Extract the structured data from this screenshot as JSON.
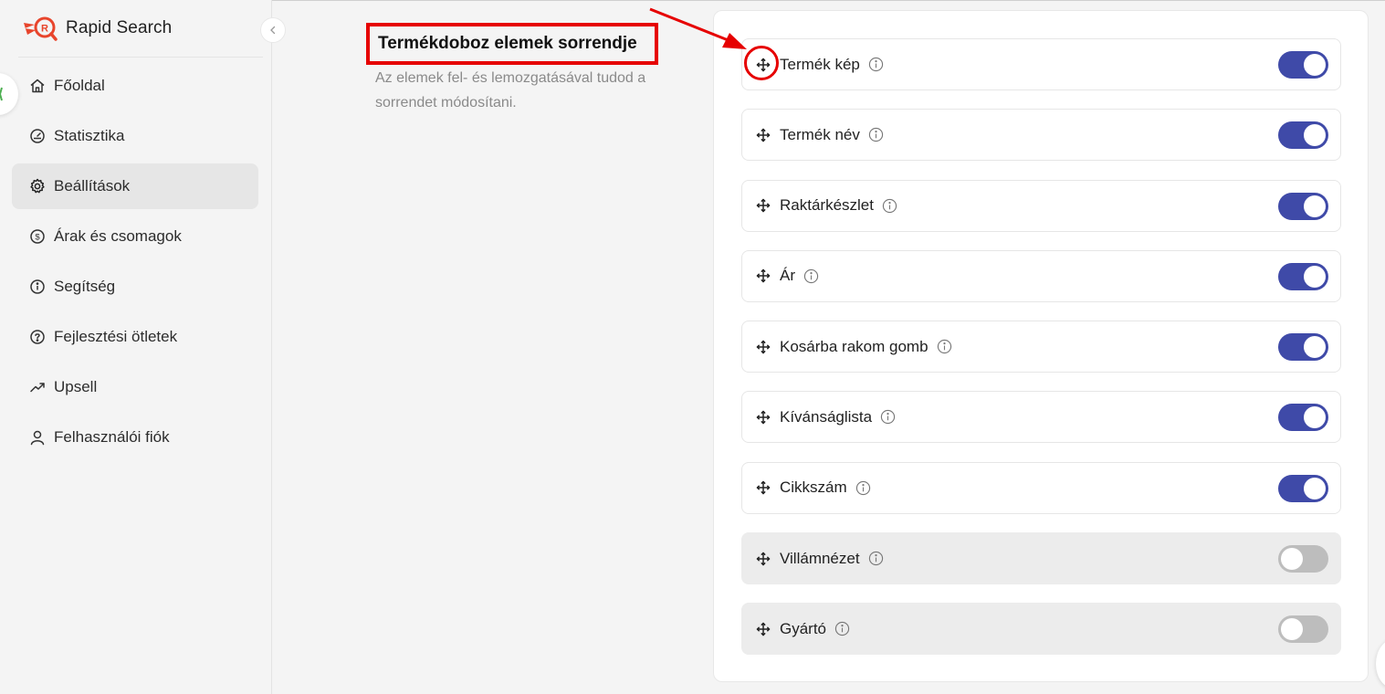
{
  "app": {
    "name": "Rapid Search"
  },
  "sidebar": {
    "items": [
      {
        "label": "Főoldal",
        "icon": "home-icon"
      },
      {
        "label": "Statisztika",
        "icon": "gauge-icon"
      },
      {
        "label": "Beállítások",
        "icon": "gear-icon",
        "active": true
      },
      {
        "label": "Árak és csomagok",
        "icon": "dollar-circle-icon"
      },
      {
        "label": "Segítség",
        "icon": "info-circle-icon"
      },
      {
        "label": "Fejlesztési ötletek",
        "icon": "question-circle-icon"
      },
      {
        "label": "Upsell",
        "icon": "trend-up-icon"
      },
      {
        "label": "Felhasználói fiók",
        "icon": "user-icon"
      }
    ]
  },
  "section": {
    "title": "Termékdoboz elemek sorrendje",
    "description": "Az elemek fel- és lemozgatásával tudod a sorrendet módosítani."
  },
  "items": [
    {
      "label": "Termék kép",
      "enabled": true
    },
    {
      "label": "Termék név",
      "enabled": true
    },
    {
      "label": "Raktárkészlet",
      "enabled": true
    },
    {
      "label": "Ár",
      "enabled": true
    },
    {
      "label": "Kosárba rakom gomb",
      "enabled": true
    },
    {
      "label": "Kívánságlista",
      "enabled": true
    },
    {
      "label": "Cikkszám",
      "enabled": true
    },
    {
      "label": "Villámnézet",
      "enabled": false
    },
    {
      "label": "Gyártó",
      "enabled": false
    }
  ],
  "colors": {
    "toggle_on": "#3f4aa8",
    "toggle_off": "#bdbdbd",
    "annotation": "#e60000",
    "brand": "#e8452c"
  }
}
